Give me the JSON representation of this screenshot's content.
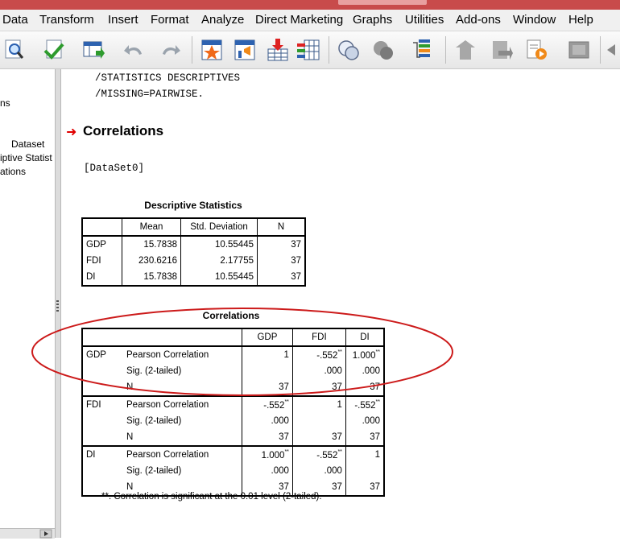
{
  "menubar": {
    "items": [
      "Data",
      "Transform",
      "Insert",
      "Format",
      "Analyze",
      "Direct Marketing",
      "Graphs",
      "Utilities",
      "Add-ons",
      "Window",
      "Help"
    ]
  },
  "toolbar": {
    "icons": [
      "find-icon",
      "go-to-data-icon",
      "go-to-variable-icon",
      "undo-icon",
      "redo-icon",
      "pivot-table-icon",
      "chart-builder-icon",
      "insert-cases-icon",
      "insert-variable-icon",
      "designate-window-icon",
      "show-all-icon",
      "select-output-icon",
      "promote-icon",
      "demote-icon",
      "insert-text-icon",
      "insert-title-icon",
      "run-script-icon",
      "collapse-icon",
      "expand-icon"
    ]
  },
  "outline": {
    "items": [
      "ns",
      "Dataset",
      "iptive Statist",
      "ations"
    ]
  },
  "syntax": {
    "line1": "/STATISTICS DESCRIPTIVES",
    "line2": "/MISSING=PAIRWISE."
  },
  "output": {
    "heading": "Correlations",
    "dataset": "[DataSet0]"
  },
  "descriptives": {
    "title": "Descriptive Statistics",
    "headers": [
      "Mean",
      "Std. Deviation",
      "N"
    ],
    "rows": [
      {
        "label": "GDP",
        "mean": "15.7838",
        "sd": "10.55445",
        "n": "37"
      },
      {
        "label": "FDI",
        "mean": "230.6216",
        "sd": "2.17755",
        "n": "37"
      },
      {
        "label": "DI",
        "mean": "15.7838",
        "sd": "10.55445",
        "n": "37"
      }
    ]
  },
  "correlations": {
    "title": "Correlations",
    "headers": [
      "GDP",
      "FDI",
      "DI"
    ],
    "stat_labels": [
      "Pearson Correlation",
      "Sig. (2-tailed)",
      "N"
    ],
    "sig_marker": "**",
    "groups": [
      {
        "var": "GDP",
        "r": [
          "1",
          "-.552",
          "1.000"
        ],
        "r_sig": [
          false,
          true,
          true
        ],
        "p": [
          "",
          ".000",
          ".000"
        ],
        "n": [
          "37",
          "37",
          "37"
        ]
      },
      {
        "var": "FDI",
        "r": [
          "-.552",
          "1",
          "-.552"
        ],
        "r_sig": [
          true,
          false,
          true
        ],
        "p": [
          ".000",
          "",
          ".000"
        ],
        "n": [
          "37",
          "37",
          "37"
        ]
      },
      {
        "var": "DI",
        "r": [
          "1.000",
          "-.552",
          "1"
        ],
        "r_sig": [
          true,
          true,
          false
        ],
        "p": [
          ".000",
          ".000",
          ""
        ],
        "n": [
          "37",
          "37",
          "37"
        ]
      }
    ],
    "footnote": "**. Correlation is significant at the 0.01 level (2-tailed)."
  },
  "colors": {
    "arrow": "#e00000",
    "annotation_ellipse": "#cc1a1a",
    "titlebar": "#c84b4b"
  }
}
